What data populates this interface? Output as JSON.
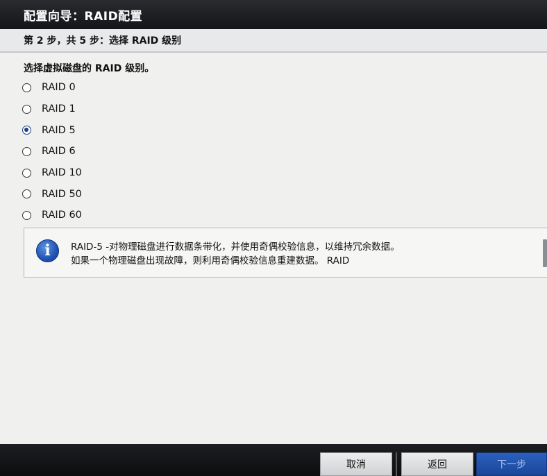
{
  "window": {
    "title": "配置向导：RAID配置"
  },
  "step": {
    "text": "第 2 步，共 5 步：选择 RAID 级别"
  },
  "prompt": "选择虚拟磁盘的 RAID 级别。",
  "raid_levels": [
    {
      "label": "RAID 0",
      "selected": false
    },
    {
      "label": "RAID 1",
      "selected": false
    },
    {
      "label": "RAID 5",
      "selected": true
    },
    {
      "label": "RAID 6",
      "selected": false
    },
    {
      "label": "RAID 10",
      "selected": false
    },
    {
      "label": "RAID 50",
      "selected": false
    },
    {
      "label": "RAID 60",
      "selected": false
    }
  ],
  "info": {
    "icon": "info-icon",
    "line1": "RAID-5 -对物理磁盘进行数据条带化，并使用奇偶校验信息，以维持冗余数据。",
    "line2": "如果一个物理磁盘出现故障，则利用奇偶校验信息重建数据。 RAID"
  },
  "buttons": {
    "cancel": "取消",
    "back": "返回",
    "next": "下一步"
  },
  "colors": {
    "titlebar": "#1c1d20",
    "selected_radio": "#1d3f86",
    "next_button": "#2356b0"
  }
}
